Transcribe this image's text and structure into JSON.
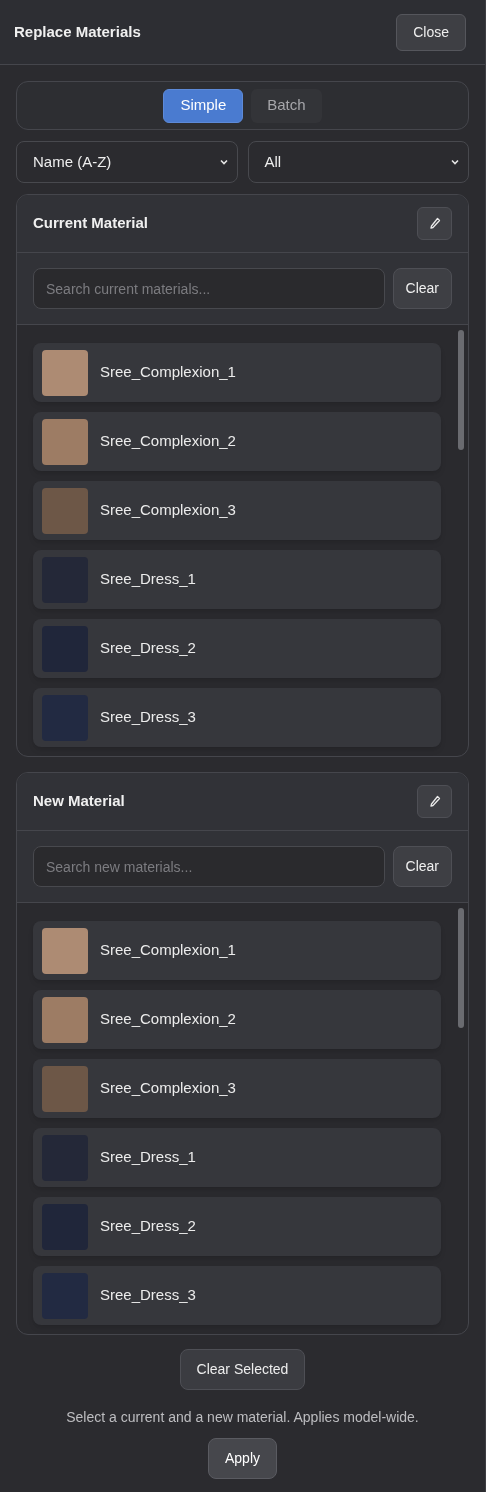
{
  "window": {
    "title": "Replace Materials",
    "close": "Close"
  },
  "modes": [
    {
      "label": "Simple",
      "selected": true
    },
    {
      "label": "Batch",
      "selected": false
    }
  ],
  "filters": {
    "sort": "Name (A-Z)",
    "category": "All"
  },
  "panels": [
    {
      "title": "Current Material",
      "placeholder": "Search current materials...",
      "clear": "Clear",
      "items": [
        {
          "name": "Sree_Complexion_1",
          "color": "#ad8b73"
        },
        {
          "name": "Sree_Complexion_2",
          "color": "#9d7c64"
        },
        {
          "name": "Sree_Complexion_3",
          "color": "#6d5747"
        },
        {
          "name": "Sree_Dress_1",
          "color": "#242838"
        },
        {
          "name": "Sree_Dress_2",
          "color": "#20263a"
        },
        {
          "name": "Sree_Dress_3",
          "color": "#222a42"
        }
      ]
    },
    {
      "title": "New Material",
      "placeholder": "Search new materials...",
      "clear": "Clear",
      "items": [
        {
          "name": "Sree_Complexion_1",
          "color": "#ad8b73"
        },
        {
          "name": "Sree_Complexion_2",
          "color": "#9d7c64"
        },
        {
          "name": "Sree_Complexion_3",
          "color": "#6d5747"
        },
        {
          "name": "Sree_Dress_1",
          "color": "#242838"
        },
        {
          "name": "Sree_Dress_2",
          "color": "#20263a"
        },
        {
          "name": "Sree_Dress_3",
          "color": "#222a42"
        }
      ]
    }
  ],
  "clear_selected": "Clear Selected",
  "hint": "Select a current and a new material. Applies model-wide.",
  "apply": "Apply"
}
